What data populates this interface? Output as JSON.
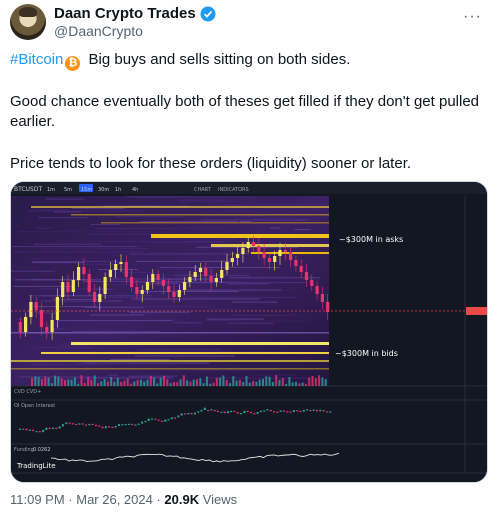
{
  "author": {
    "display_name": "Daan Crypto Trades",
    "handle": "@DaanCrypto",
    "more_icon": "more-icon"
  },
  "tweet": {
    "hashtag": "#Bitcoin",
    "line1_rest": " Big buys and sells sitting on both sides.",
    "para2": "Good chance eventually both of theses get filled if they don't get pulled earlier.",
    "para3": "Price tends to look for these orders (liquidity) sooner or later."
  },
  "chart": {
    "symbol": "BTCUSDT",
    "timeframes": [
      "1m",
      "5m",
      "15m",
      "30m",
      "1h",
      "4h"
    ],
    "menu": [
      "CHART",
      "INDICATORS"
    ],
    "annotation_asks": "~$300M in asks",
    "annotation_bids": "~$300M in bids",
    "panel_cvd": "CVD CVD+",
    "panel_oi": "OI Open Interest",
    "panel_funding": "Funding",
    "funding_value": "0.0262",
    "watermark": "TradingLite",
    "colors": {
      "background": "#131722",
      "up": "#f5e663",
      "down": "#e8336b",
      "price_line": "#e84a4a",
      "ask_band": "#f0c419"
    }
  },
  "footer": {
    "time": "11:09 PM",
    "sep": " · ",
    "date": "Mar 26, 2024",
    "views_count": "20.9K",
    "views_label": " Views"
  }
}
